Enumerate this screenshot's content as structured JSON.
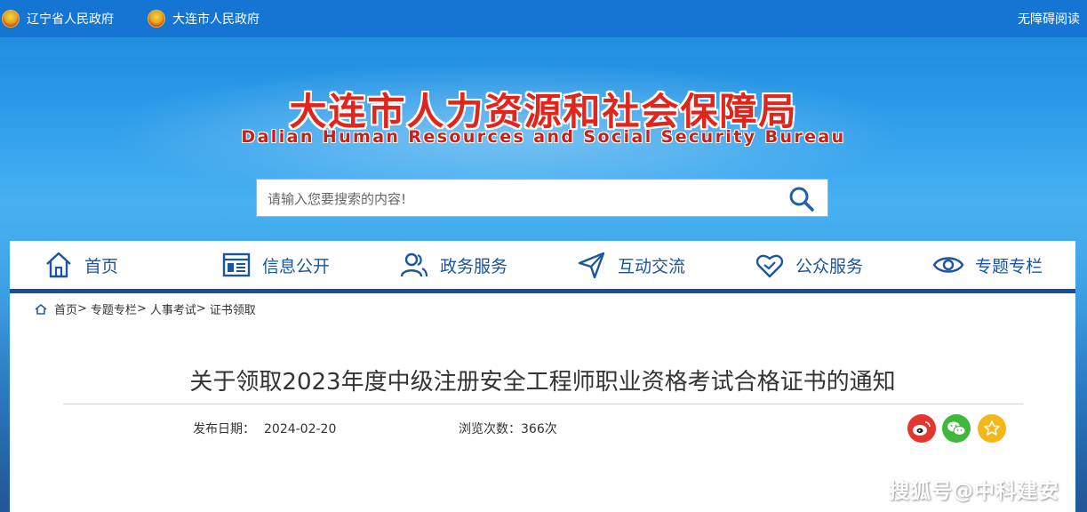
{
  "topbar": {
    "links": [
      "辽宁省人民政府",
      "大连市人民政府"
    ],
    "accessibility": "无障碍阅读"
  },
  "logo": {
    "name_cn": "大连市人力资源和社会保障局",
    "name_en": "Dalian Human Resources and Social Security Bureau"
  },
  "search": {
    "placeholder": "请输入您要搜索的内容!",
    "value": ""
  },
  "nav": {
    "items": [
      {
        "label": "首页",
        "icon": "home-icon"
      },
      {
        "label": "信息公开",
        "icon": "document-icon"
      },
      {
        "label": "政务服务",
        "icon": "people-icon"
      },
      {
        "label": "互动交流",
        "icon": "send-icon"
      },
      {
        "label": "公众服务",
        "icon": "heart-icon"
      },
      {
        "label": "专题专栏",
        "icon": "eye-icon"
      }
    ]
  },
  "breadcrumb": {
    "home": "首页",
    "items": [
      "专题专栏",
      "人事考试",
      "证书领取"
    ],
    "separator": ">"
  },
  "article": {
    "title": "关于领取2023年度中级注册安全工程师职业资格考试合格证书的通知",
    "date_label": "发布日期：",
    "date": "2024-02-20",
    "views_label": "浏览次数：",
    "views": "366次"
  },
  "share": {
    "icons": [
      "weibo-icon",
      "wechat-icon",
      "favorite-icon"
    ],
    "colors": {
      "weibo": "#e2362f",
      "wechat": "#3fb83c",
      "favorite": "#f3b71b"
    }
  },
  "watermark": "搜狐号@中科建安",
  "colors": {
    "topbar": "#1476d2",
    "nav_text": "#1b55a0",
    "nav_underline": "#15519a",
    "logo_red": "#e0261c"
  }
}
